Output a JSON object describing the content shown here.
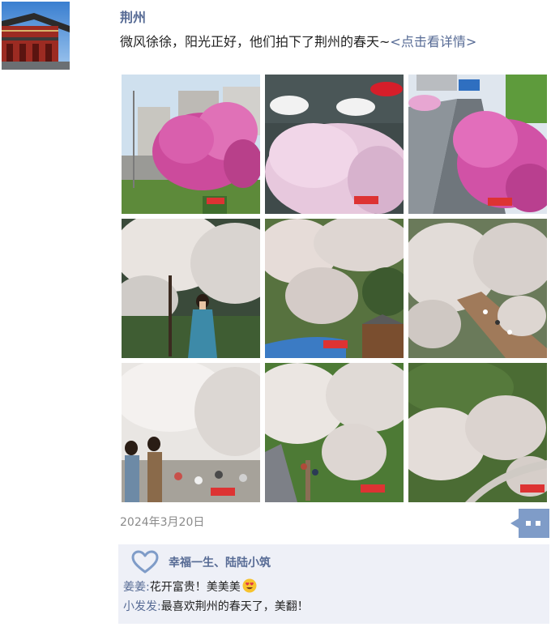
{
  "post": {
    "author": "荆州",
    "text": "微风徐徐，阳光正好，他们拍下了荆州的春天~",
    "link_text": "<点击看详情>",
    "date": "2024年3月20日"
  },
  "photos": [
    {
      "name": "photo-magnolia-roadside",
      "watermark": "极目新闻"
    },
    {
      "name": "photo-magnolia-parking",
      "watermark": "极目新闻"
    },
    {
      "name": "photo-magnolia-avenue",
      "watermark": "极目新闻"
    },
    {
      "name": "photo-woman-hanfu",
      "watermark": ""
    },
    {
      "name": "photo-park-aerial",
      "watermark": "极目新闻"
    },
    {
      "name": "photo-walkway-aerial",
      "watermark": ""
    },
    {
      "name": "photo-visitors-cherry",
      "watermark": "极目新闻"
    },
    {
      "name": "photo-cherry-path",
      "watermark": "极目新闻"
    },
    {
      "name": "photo-cherry-garden",
      "watermark": "极目新闻"
    }
  ],
  "likes": {
    "icon": "heart-icon",
    "names": "幸福一生、陆陆小筑"
  },
  "comments": [
    {
      "author": "姜姜:",
      "text": "花开富贵！美美美",
      "emoji": "heart-eyes-emoji"
    },
    {
      "author": "小发发:",
      "text": "最喜欢荆州的春天了，美翻！"
    }
  ],
  "colors": {
    "link": "#576b95",
    "comment_bg": "#eef0f7",
    "comment_button": "#7f9cc8"
  }
}
